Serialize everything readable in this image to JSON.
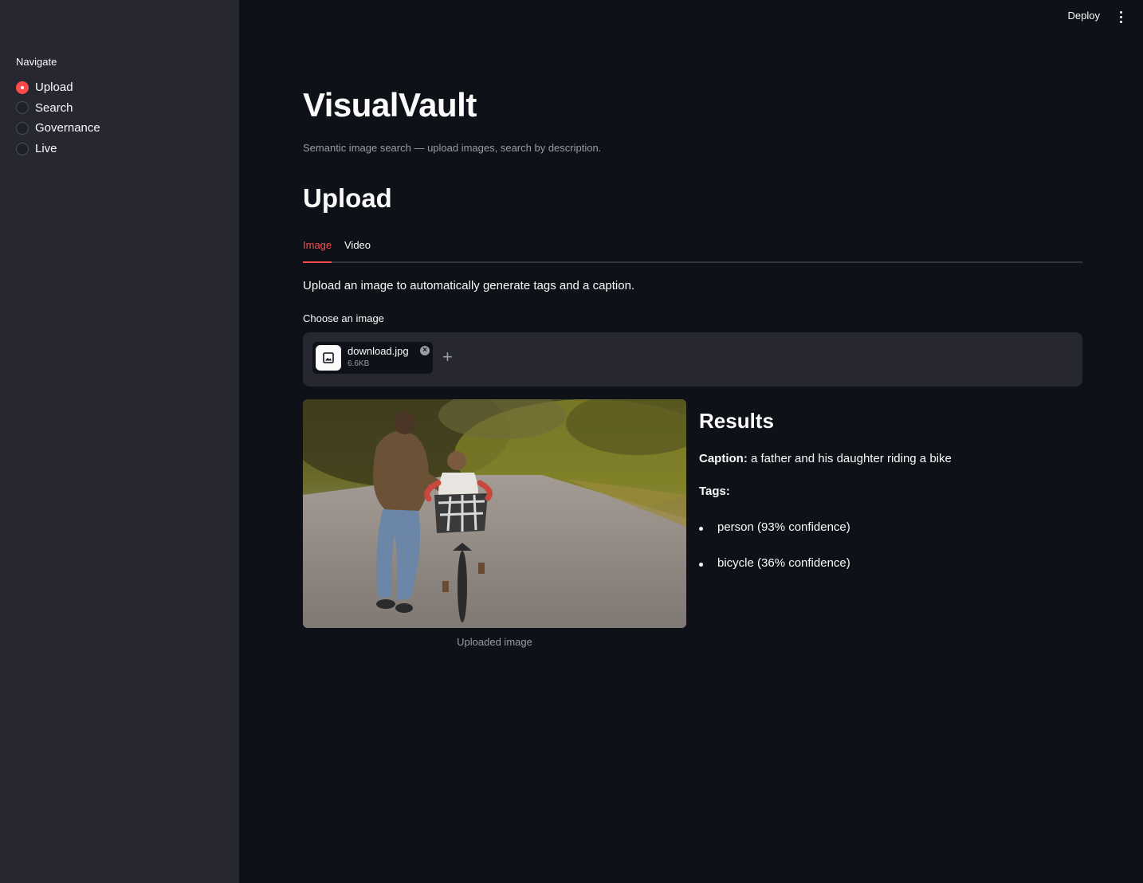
{
  "sidebar": {
    "heading": "Navigate",
    "items": [
      {
        "label": "Upload",
        "selected": true
      },
      {
        "label": "Search",
        "selected": false
      },
      {
        "label": "Governance",
        "selected": false
      },
      {
        "label": "Live",
        "selected": false
      }
    ]
  },
  "toolbar": {
    "deploy_label": "Deploy",
    "menu_icon": "more-vertical-icon"
  },
  "header": {
    "title": "VisualVault",
    "subtitle": "Semantic image search — upload images, search by description."
  },
  "section": {
    "title": "Upload",
    "tabs": [
      {
        "label": "Image",
        "active": true
      },
      {
        "label": "Video",
        "active": false
      }
    ],
    "intro": "Upload an image to automatically generate tags and a caption."
  },
  "uploader": {
    "label": "Choose an image",
    "file": {
      "name": "download.jpg",
      "size": "6.6KB",
      "icon": "image-file-icon"
    },
    "remove_icon": "close-circle-icon",
    "add_label": "+"
  },
  "image": {
    "caption": "Uploaded image"
  },
  "results": {
    "title": "Results",
    "caption_label": "Caption:",
    "caption_text": "a father and his daughter riding a bike",
    "tags_label": "Tags:",
    "tags": [
      "person (93% confidence)",
      "bicycle (36% confidence)"
    ]
  },
  "colors": {
    "background": "#0e1117",
    "sidebar": "#262730",
    "accent": "#ff4b4b",
    "text": "#fafafa",
    "muted": "#9a9ca5"
  }
}
